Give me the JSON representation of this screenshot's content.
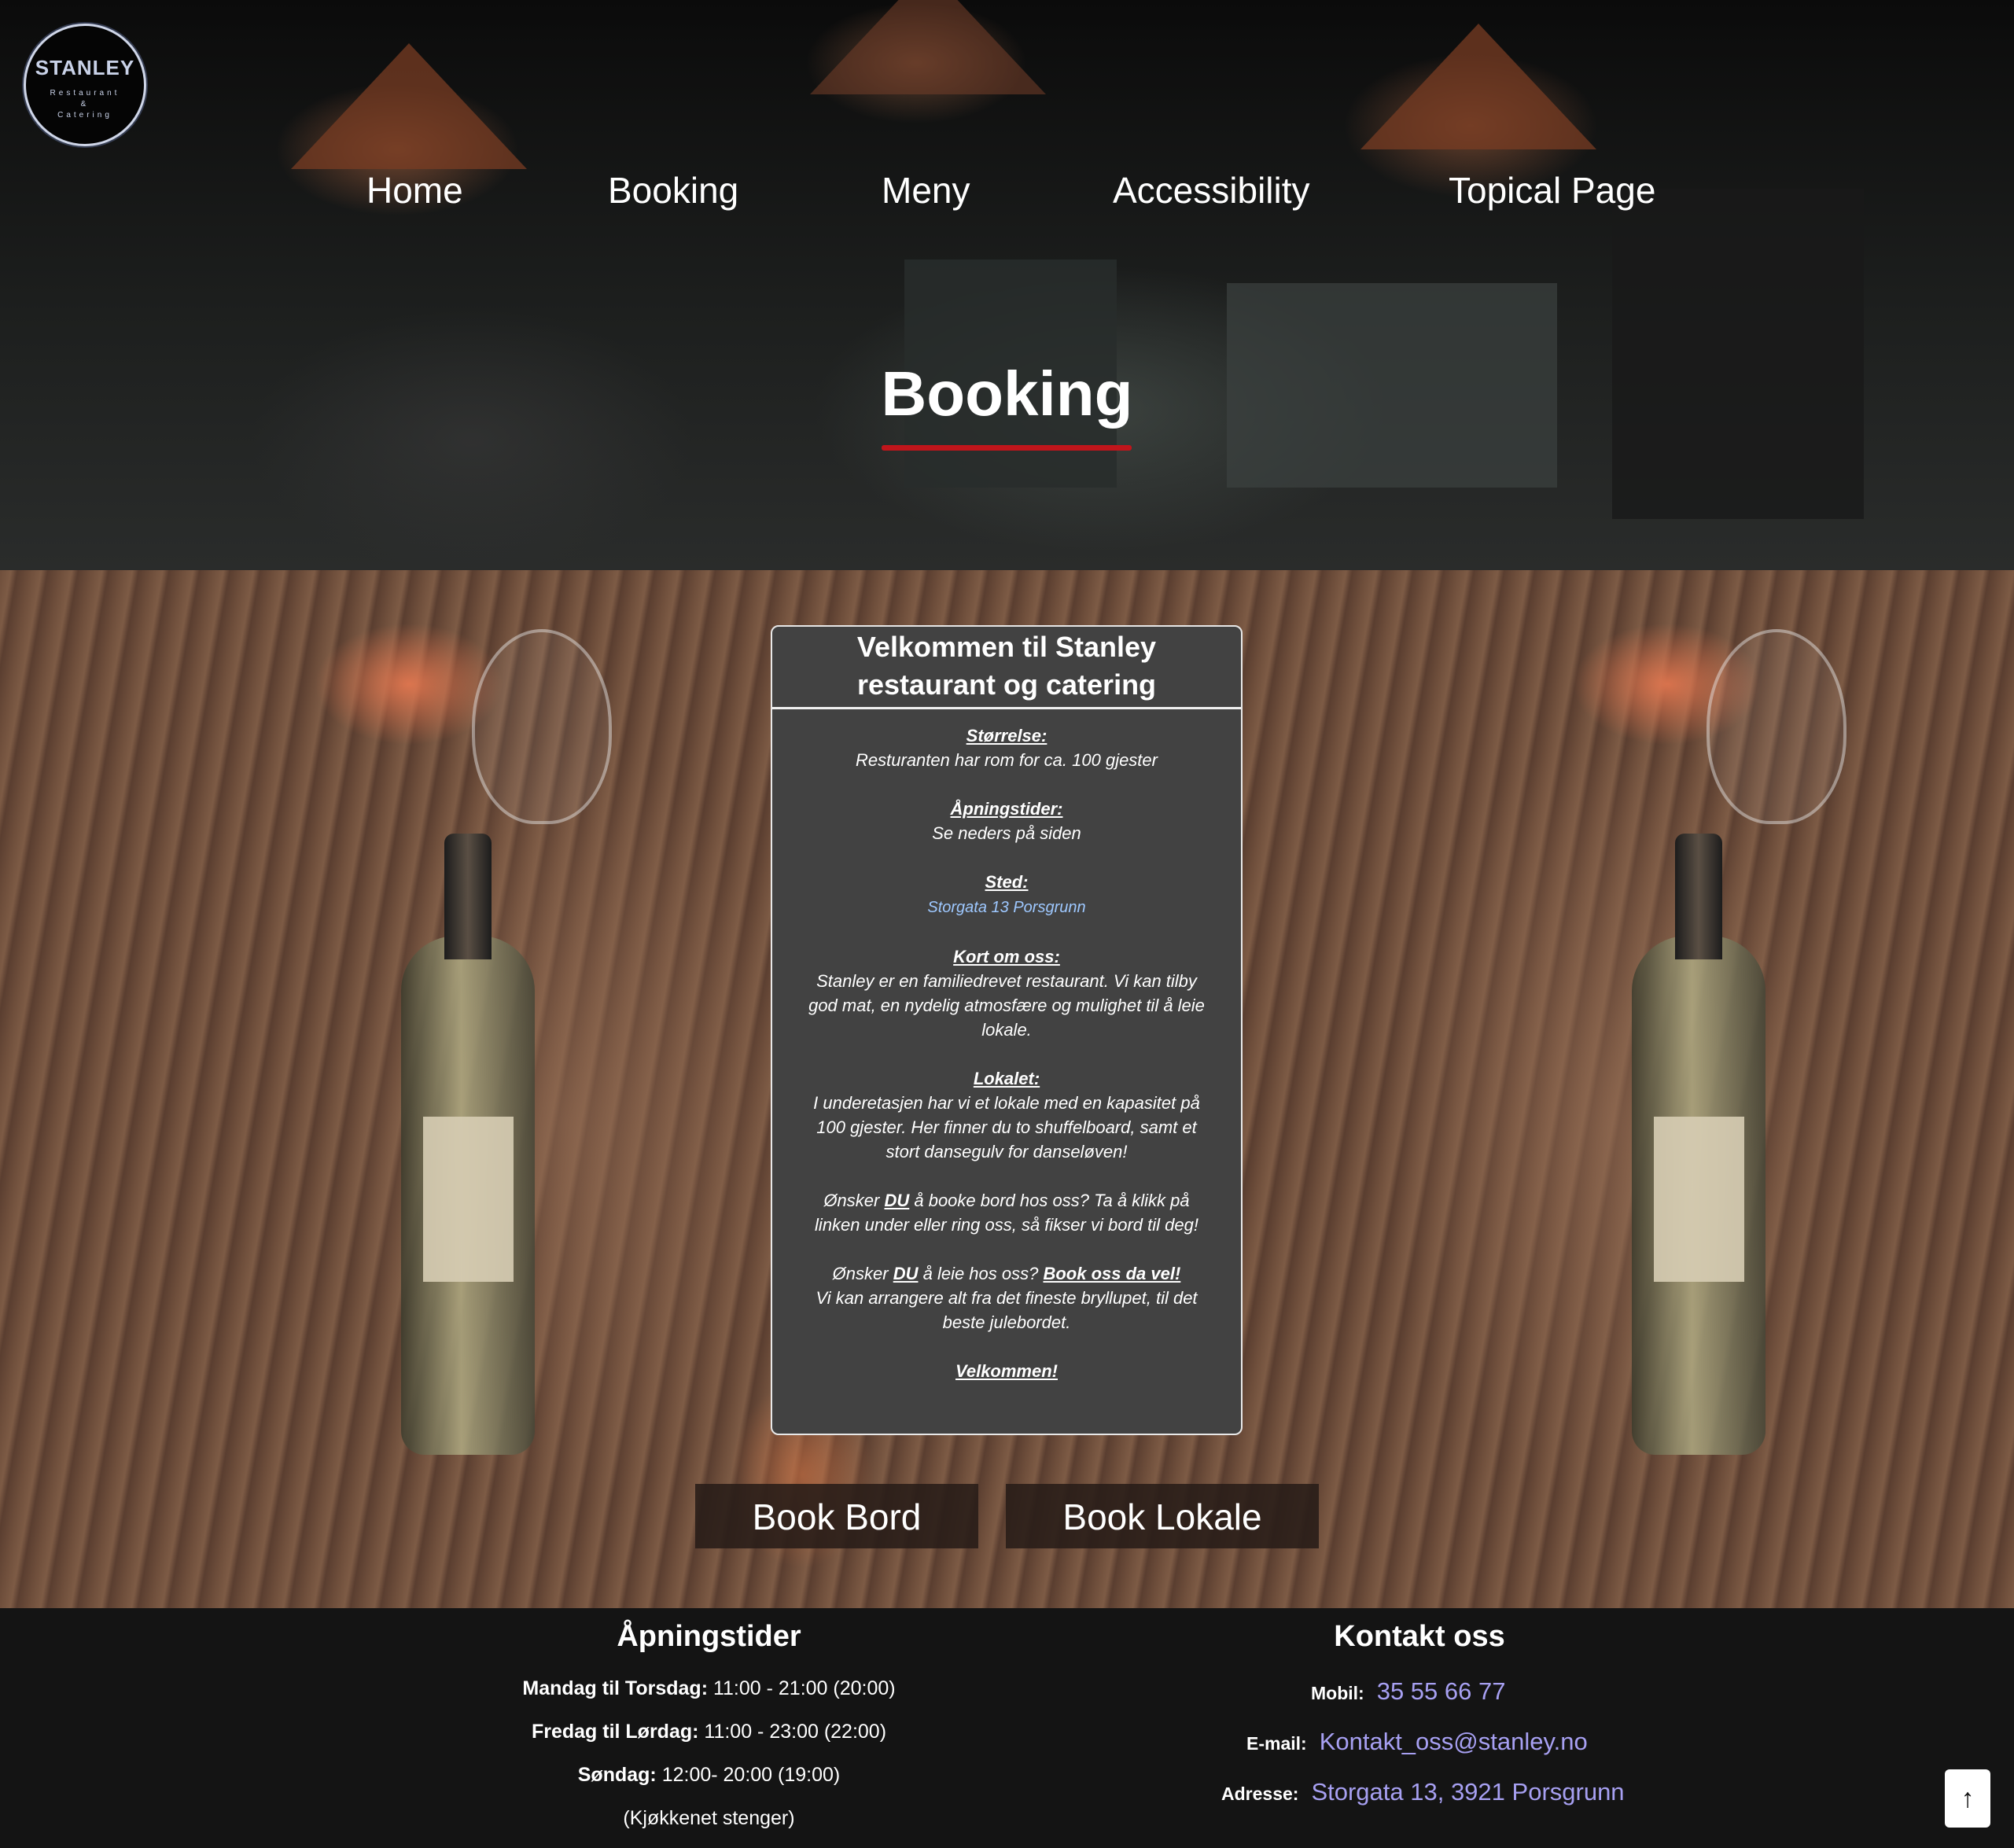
{
  "logo": {
    "name": "STANLEY",
    "line2": "Restaurant",
    "line3": "&",
    "line4": "Catering"
  },
  "nav": {
    "items": [
      {
        "label": "Home"
      },
      {
        "label": "Booking"
      },
      {
        "label": "Meny"
      },
      {
        "label": "Accessibility"
      },
      {
        "label": "Topical Page"
      }
    ]
  },
  "hero": {
    "title": "Booking"
  },
  "card": {
    "title": "Velkommen til Stanley restaurant og catering",
    "size_heading": "Størrelse:",
    "size_text": "Resturanten har rom for ca. 100 gjester",
    "hours_heading": "Åpningstider:",
    "hours_text": "Se neders på siden",
    "place_heading": "Sted:",
    "place_text": "Storgata 13 Porsgrunn",
    "about_heading": "Kort om oss:",
    "about_text": "Stanley er en familiedrevet restaurant. Vi kan tilby god mat, en nydelig atmosfære og mulighet til å leie lokale.",
    "venue_heading": "Lokalet:",
    "venue_text": "I underetasjen har vi et lokale med en kapasitet på 100 gjester. Her finner du to shuffelboard, samt et stort dansegulv for danseløven!",
    "book_table_pre": "Ønsker ",
    "book_table_du": "DU",
    "book_table_post": " å booke bord hos oss? Ta å klikk på linken under eller ring oss, så fikser vi bord til deg!",
    "rent_pre": "Ønsker ",
    "rent_du": "DU",
    "rent_mid": " å leie hos oss? ",
    "rent_link": "Book oss da vel!",
    "rent_post": "Vi kan arrangere alt fra det fineste bryllupet, til det beste julebordet.",
    "welcome": "Velkommen!"
  },
  "buttons": {
    "book_table": "Book Bord",
    "book_venue": "Book Lokale"
  },
  "footer": {
    "hours_title": "Åpningstider",
    "hours": [
      {
        "day": "Mandag til Torsdag:",
        "time": " 11:00 - 21:00 (20:00)"
      },
      {
        "day": "Fredag til Lørdag:",
        "time": " 11:00 - 23:00 (22:00)"
      },
      {
        "day": "Søndag:",
        "time": " 12:00- 20:00 (19:00)"
      }
    ],
    "kitchen_note": "(Kjøkkenet stenger)",
    "contact_title": "Kontakt oss",
    "mobile_label": "Mobil:",
    "mobile_value": "35 55 66 77",
    "email_label": "E-mail:",
    "email_value": "Kontakt_oss@stanley.no",
    "address_label": "Adresse:",
    "address_value": "Storgata 13, 3921 Porsgrunn"
  },
  "scroll_top": {
    "glyph": "↑"
  },
  "colors": {
    "accent_underline": "#c0151b",
    "link": "#a7a0f2",
    "card_bg": "#424242",
    "footer_bg": "#141414"
  }
}
